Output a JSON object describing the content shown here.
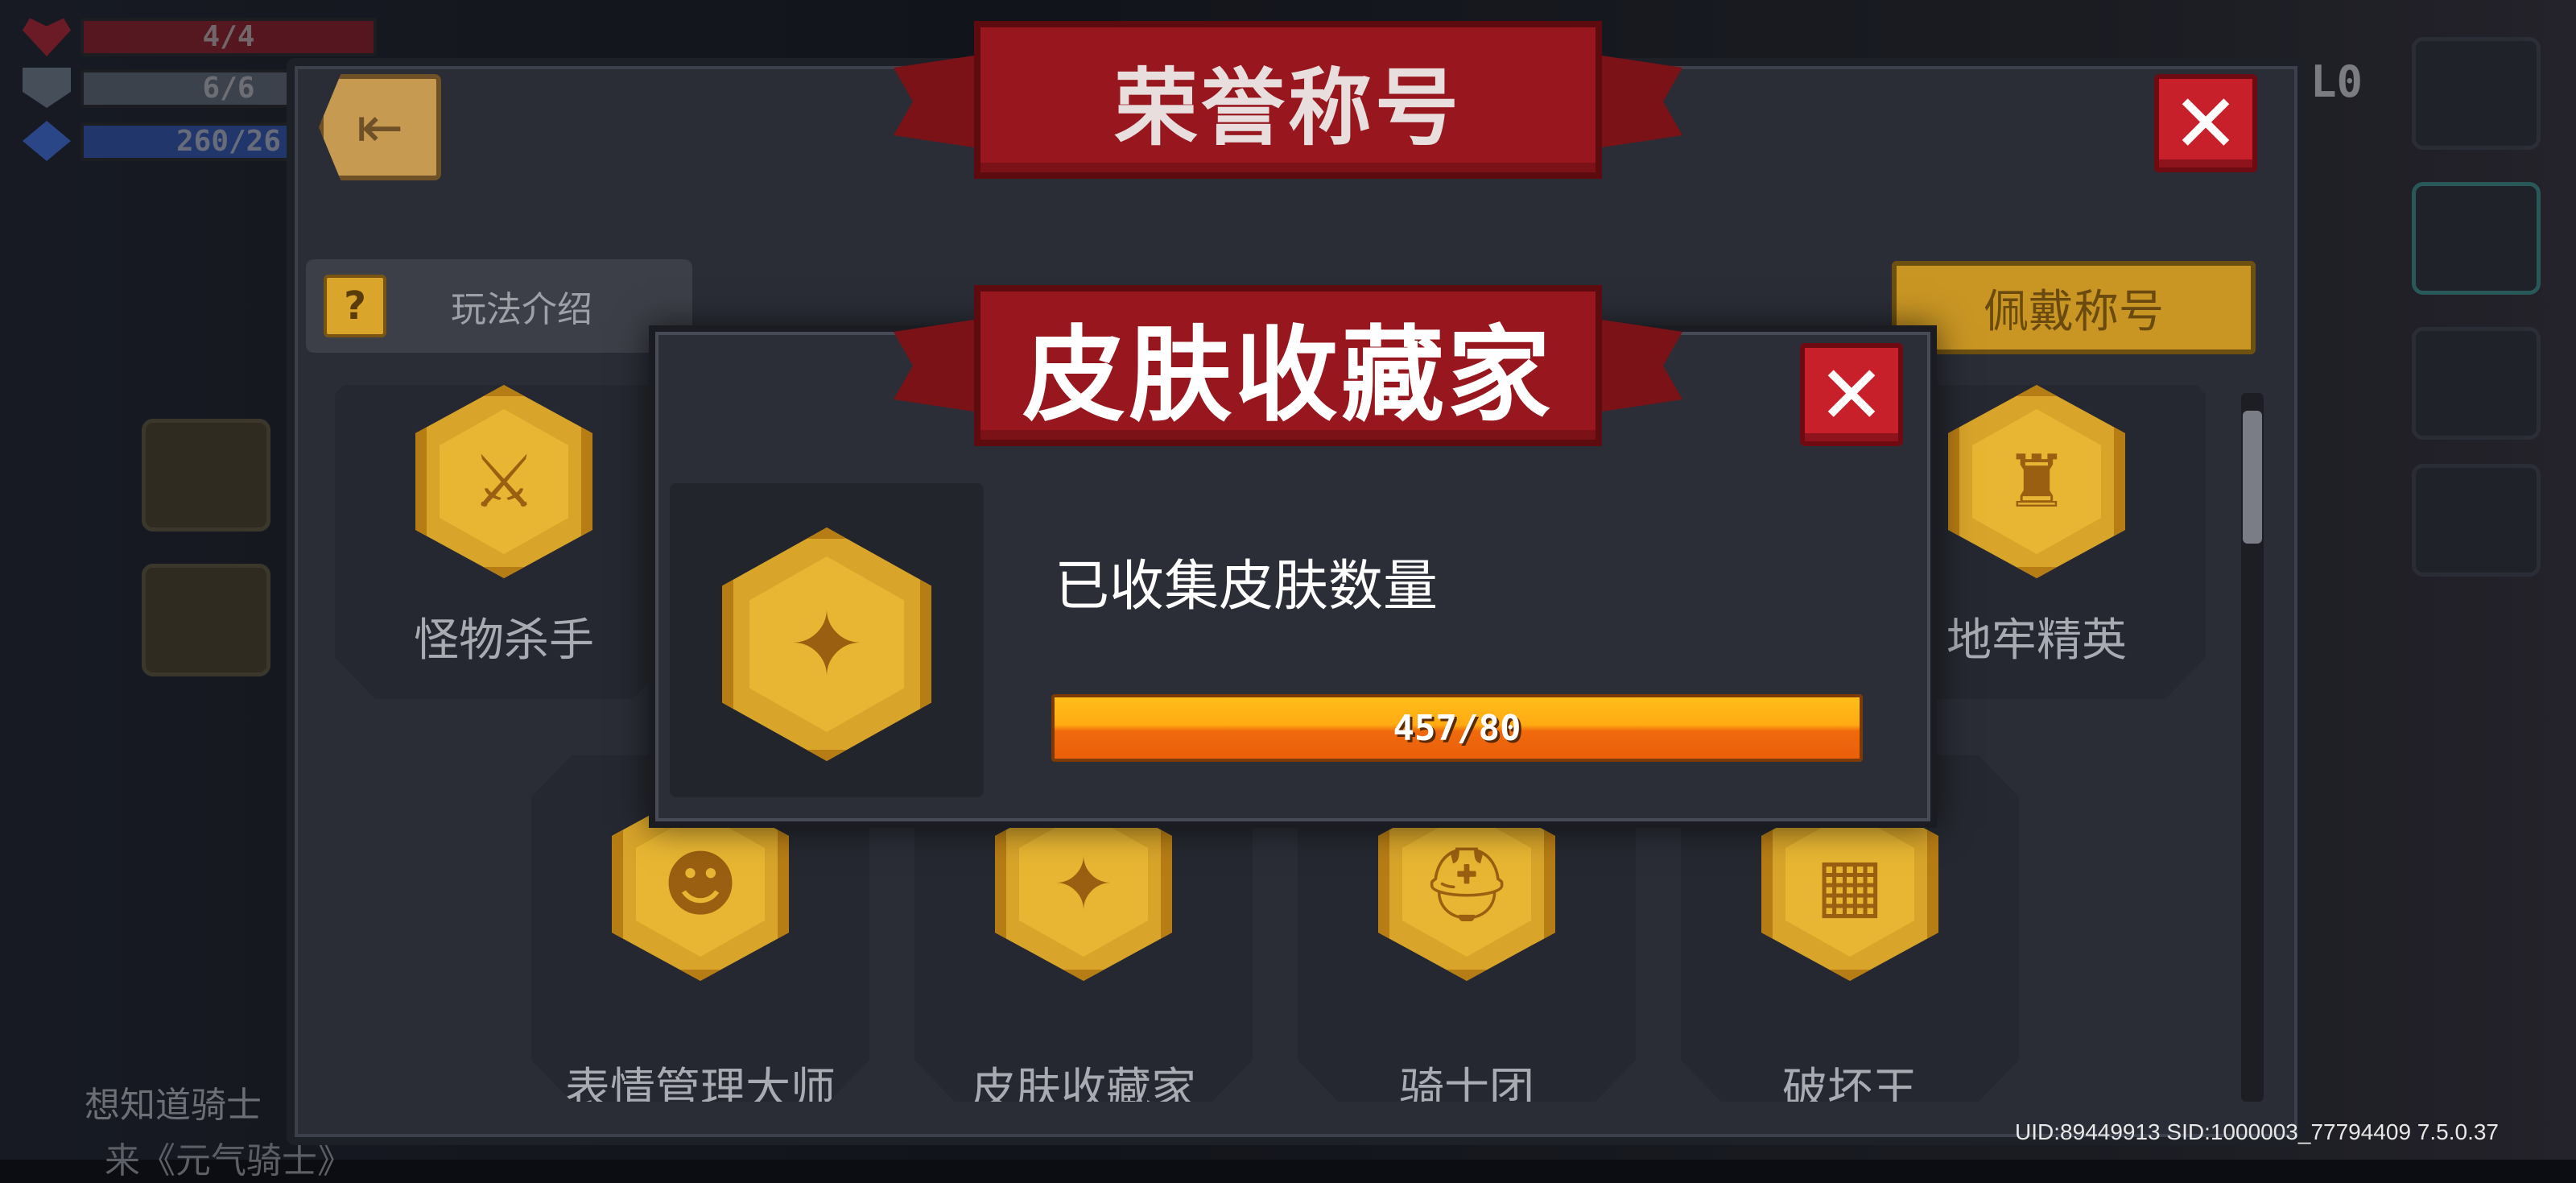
{
  "hud": {
    "hp": "4/4",
    "armor": "6/6",
    "energy": "260/26",
    "right_counter": "L0"
  },
  "honor_panel": {
    "title": "荣誉称号",
    "how_to_play": "玩法介绍",
    "help_icon": "?",
    "wear_title": "佩戴称号",
    "titles": [
      {
        "label": "怪物杀手",
        "icon": "crossed-swords-badge-icon",
        "glyph": "⚔"
      },
      {
        "label": "地牢精英",
        "icon": "tower-badge-icon",
        "glyph": "♜"
      },
      {
        "label": "表情管理大师",
        "icon": "smiley-badge-icon",
        "glyph": "☻"
      },
      {
        "label": "皮肤收藏家",
        "icon": "bag-badge-icon",
        "glyph": "✦"
      },
      {
        "label": "骑士团",
        "icon": "helmet-badge-icon",
        "glyph": "⛑"
      },
      {
        "label": "破坏王",
        "icon": "broken-wall-badge-icon",
        "glyph": "▦"
      }
    ]
  },
  "popup": {
    "title": "皮肤收藏家",
    "description": "已收集皮肤数量",
    "progress_text": "457/80",
    "progress_fraction": 1.0
  },
  "background_hint": {
    "line1": "想知道骑士",
    "line2": "来《元气骑士》"
  },
  "footer": {
    "uid": "UID:89449913 SID:1000003_77794409 7.5.0.37"
  },
  "colors": {
    "ribbon": "#98171f",
    "gold": "#d8a52a",
    "close": "#c8202b",
    "progress": "#ffaa12"
  }
}
